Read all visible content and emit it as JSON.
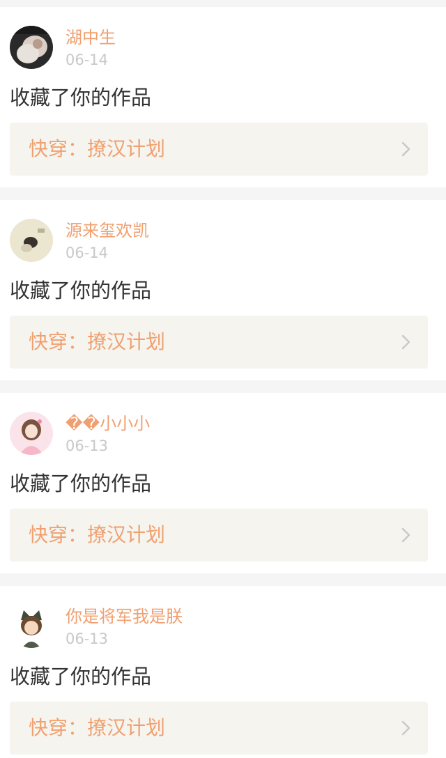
{
  "feed": {
    "items": [
      {
        "username": "湖中生",
        "time": "06-14",
        "action": "收藏了你的作品",
        "work_title": "快穿：撩汉计划"
      },
      {
        "username": "源来玺欢凯",
        "time": "06-14",
        "action": "收藏了你的作品",
        "work_title": "快穿：撩汉计划"
      },
      {
        "username": "��小小小",
        "time": "06-13",
        "action": "收藏了你的作品",
        "work_title": "快穿：撩汉计划"
      },
      {
        "username": "你是将军我是朕",
        "time": "06-13",
        "action": "收藏了你的作品",
        "work_title": "快穿：撩汉计划"
      }
    ]
  },
  "colors": {
    "page_bg": "#f5f5f5",
    "card_bg": "#ffffff",
    "accent": "#f0a070",
    "time_text": "#c8c8c8",
    "action_text": "#333333",
    "work_bg": "#f5f4ee",
    "chevron": "#c8c8c8"
  },
  "icons": {
    "chevron": "chevron-right-icon",
    "avatar": "avatar-image"
  }
}
